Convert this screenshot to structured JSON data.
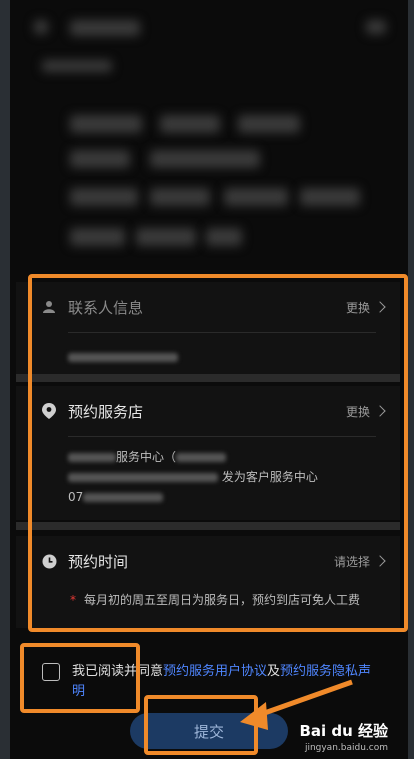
{
  "contact": {
    "title": "联系人信息",
    "action": "更换"
  },
  "store": {
    "title": "预约服务店",
    "action": "更换",
    "line1_suffix": "服务中心（",
    "line2_suffix": "发为客户服务中心",
    "phone_prefix": "07"
  },
  "time": {
    "title": "预约时间",
    "action": "请选择",
    "note": "每月初的周五至周日为服务日，预约到店可免人工费"
  },
  "agreement": {
    "prefix": "我已阅读并同意",
    "link1": "预约服务用户协议",
    "and": "及",
    "link2": "预约服务隐私声明"
  },
  "submit_label": "提交",
  "watermark": {
    "brand": "Bai du 经验",
    "url": "jingyan.baidu.com"
  },
  "colors": {
    "highlight": "#f08a2a",
    "link": "#4f86ff",
    "button": "#1c3a63",
    "required_star": "#e53935"
  }
}
